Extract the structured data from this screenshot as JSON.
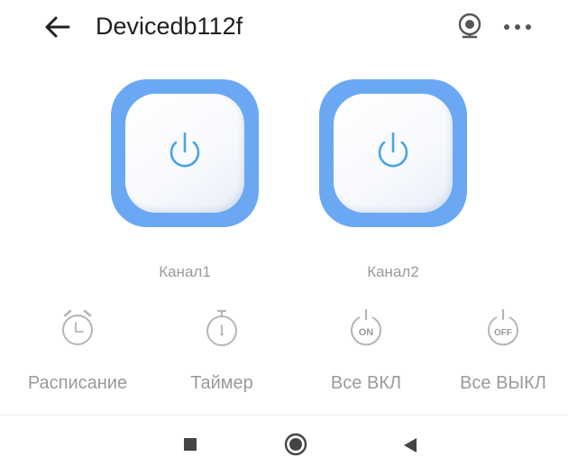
{
  "header": {
    "title": "Devicedb112f"
  },
  "icons": {
    "back": "arrow-left-icon",
    "camera": "webcam-icon",
    "more": "more-dots-icon",
    "power": "power-icon",
    "alarm": "alarm-clock-icon",
    "timer": "stopwatch-icon",
    "all_on": "power-on-icon",
    "all_off": "power-off-icon"
  },
  "channels": [
    {
      "label": "Канал1"
    },
    {
      "label": "Канал2"
    }
  ],
  "actions": {
    "schedule": "Расписание",
    "timer": "Таймер",
    "all_on": "Все ВКЛ",
    "all_off": "Все ВЫКЛ",
    "on_badge": "ON",
    "off_badge": "OFF"
  },
  "colors": {
    "channel_frame": "#6aa8f3",
    "power_icon": "#4aa3e8",
    "muted_text": "#9a9a9a"
  }
}
